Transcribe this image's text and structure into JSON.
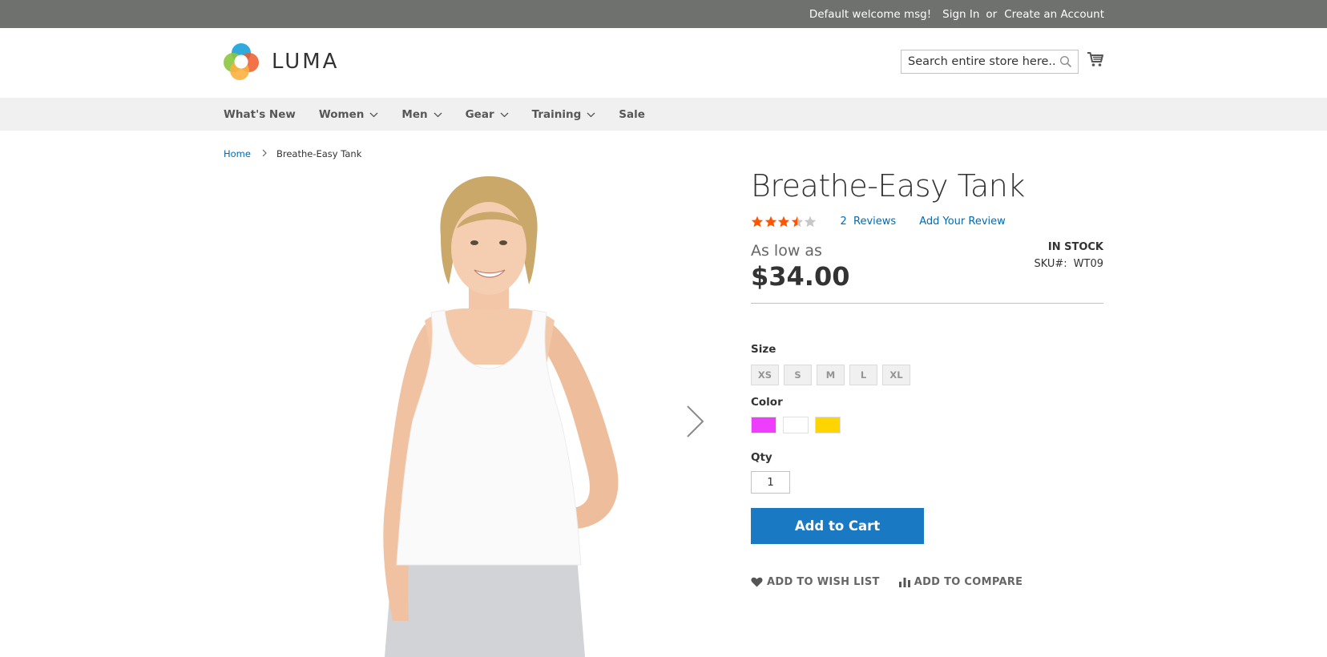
{
  "top_panel": {
    "welcome": "Default welcome msg!",
    "sign_in": "Sign In",
    "or": "or",
    "create_account": "Create an Account"
  },
  "header": {
    "logo_text": "LUMA",
    "search_placeholder": "Search entire store here...",
    "icons": {
      "search": "search-icon",
      "cart": "cart-icon"
    }
  },
  "nav": {
    "items": [
      {
        "label": "What's New",
        "has_dropdown": false
      },
      {
        "label": "Women",
        "has_dropdown": true
      },
      {
        "label": "Men",
        "has_dropdown": true
      },
      {
        "label": "Gear",
        "has_dropdown": true
      },
      {
        "label": "Training",
        "has_dropdown": true
      },
      {
        "label": "Sale",
        "has_dropdown": false
      }
    ]
  },
  "breadcrumb": {
    "home": "Home",
    "current": "Breathe-Easy Tank"
  },
  "product": {
    "title": "Breathe-Easy Tank",
    "rating_out_of_5": 3.5,
    "reviews_count": "2",
    "reviews_label": "Reviews",
    "add_review": "Add Your Review",
    "price_prefix": "As low as",
    "price": "$34.00",
    "stock": "IN STOCK",
    "sku_label": "SKU#:",
    "sku": "WT09",
    "size_label": "Size",
    "sizes": [
      "XS",
      "S",
      "M",
      "L",
      "XL"
    ],
    "color_label": "Color",
    "colors": [
      "#ef3dff",
      "#ffffff",
      "#ffd500"
    ],
    "qty_label": "Qty",
    "qty_value": "1",
    "add_to_cart": "Add to Cart",
    "add_to_wishlist": "ADD TO WISH LIST",
    "add_to_compare": "ADD TO COMPARE"
  },
  "colors": {
    "top_panel_bg": "#6e716e",
    "nav_bg": "#f0f0f0",
    "link": "#006bb4",
    "primary_button": "#1979c3",
    "star_filled": "#ff5501",
    "star_empty": "#c7c7c7"
  }
}
